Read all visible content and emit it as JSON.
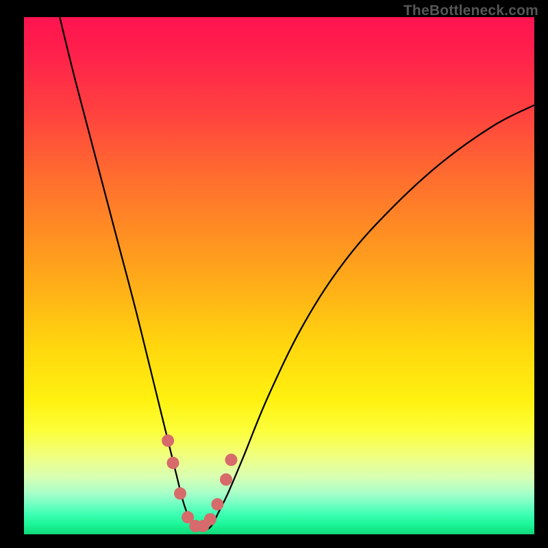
{
  "watermark": "TheBottleneck.com",
  "chart_data": {
    "type": "line",
    "title": "",
    "xlabel": "",
    "ylabel": "",
    "xlim": [
      0,
      100
    ],
    "ylim": [
      0,
      100
    ],
    "grid": false,
    "series": [
      {
        "name": "bottleneck-curve",
        "x": [
          7,
          10,
          14,
          18,
          22,
          26,
          28,
          30,
          31,
          32,
          33,
          34,
          35,
          36,
          37,
          38,
          40,
          43,
          48,
          55,
          63,
          72,
          82,
          92,
          100
        ],
        "y": [
          100,
          88,
          73,
          58,
          43,
          27,
          19,
          11,
          7,
          4,
          2,
          1,
          1,
          1,
          2,
          4,
          8,
          15,
          27,
          41,
          53,
          63,
          72,
          79,
          83
        ]
      }
    ],
    "markers": {
      "name": "highlight-dots",
      "x": [
        28.2,
        29.2,
        30.6,
        32.1,
        33.6,
        35.1,
        36.5,
        37.9,
        39.6,
        40.6
      ],
      "y": [
        18.1,
        13.8,
        7.9,
        3.3,
        1.6,
        1.6,
        2.9,
        5.8,
        10.6,
        14.4
      ]
    },
    "colors": {
      "curve": "#000000",
      "markers": "#d76a6a",
      "gradient_top": "#ff1450",
      "gradient_bottom": "#10d878"
    }
  }
}
